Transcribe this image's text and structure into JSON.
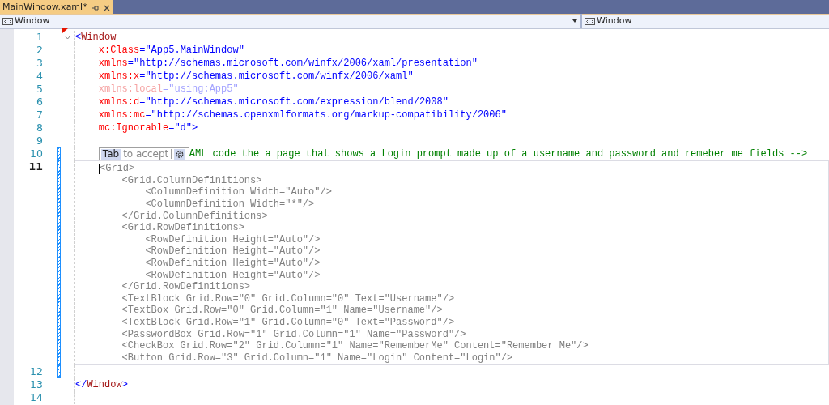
{
  "tab": {
    "title": "MainWindow.xaml*",
    "pinned": false
  },
  "nav": {
    "left": "Window",
    "right": "Window"
  },
  "lines": [
    {
      "number": "1",
      "changed": false,
      "current": false,
      "fold": true,
      "error_mark": true,
      "tokens": [
        {
          "kind": "bracket",
          "text": "<"
        },
        {
          "kind": "tag",
          "text": "Window"
        }
      ]
    },
    {
      "number": "2",
      "changed": false,
      "current": false,
      "tokens": [
        {
          "kind": "attr",
          "text": "    x:Class"
        },
        {
          "kind": "value",
          "text": "=\"App5.MainWindow\""
        }
      ]
    },
    {
      "number": "3",
      "changed": false,
      "current": false,
      "tokens": [
        {
          "kind": "attr",
          "text": "    xmlns"
        },
        {
          "kind": "value",
          "text": "=\"http://schemas.microsoft.com/winfx/2006/xaml/presentation\""
        }
      ]
    },
    {
      "number": "4",
      "changed": false,
      "current": false,
      "tokens": [
        {
          "kind": "attr",
          "text": "    xmlns:x"
        },
        {
          "kind": "value",
          "text": "=\"http://schemas.microsoft.com/winfx/2006/xaml\""
        }
      ]
    },
    {
      "number": "5",
      "changed": false,
      "current": false,
      "tokens": [
        {
          "kind": "faded_attr",
          "text": "    xmlns:local"
        },
        {
          "kind": "faded_value",
          "text": "=\"using:App5\""
        }
      ]
    },
    {
      "number": "6",
      "changed": false,
      "current": false,
      "tokens": [
        {
          "kind": "attr",
          "text": "    xmlns:d"
        },
        {
          "kind": "value",
          "text": "=\"http://schemas.microsoft.com/expression/blend/2008\""
        }
      ]
    },
    {
      "number": "7",
      "changed": false,
      "current": false,
      "tokens": [
        {
          "kind": "attr",
          "text": "    xmlns:mc"
        },
        {
          "kind": "value",
          "text": "=\"http://schemas.openxmlformats.org/markup-compatibility/2006\""
        }
      ]
    },
    {
      "number": "8",
      "changed": false,
      "current": false,
      "tokens": [
        {
          "kind": "attr",
          "text": "    mc:Ignorable"
        },
        {
          "kind": "value",
          "text": "=\"d\">"
        }
      ]
    },
    {
      "number": "9",
      "changed": false,
      "current": false
    },
    {
      "number": "10",
      "changed": true,
      "current": false,
      "hint": {
        "key": "Tab",
        "text": "to accept"
      },
      "tokens": [
        {
          "kind": "comment",
          "text": "AML code the a page that shows a Login prompt made up of a username and password and remeber me fields -->"
        }
      ]
    },
    {
      "number": "11",
      "changed": true,
      "current": true,
      "ghost": [
        "<Grid>",
        "        <Grid.ColumnDefinitions>",
        "            <ColumnDefinition Width=\"Auto\"/>",
        "            <ColumnDefinition Width=\"*\"/>",
        "        </Grid.ColumnDefinitions>",
        "        <Grid.RowDefinitions>",
        "            <RowDefinition Height=\"Auto\"/>",
        "            <RowDefinition Height=\"Auto\"/>",
        "            <RowDefinition Height=\"Auto\"/>",
        "            <RowDefinition Height=\"Auto\"/>",
        "        </Grid.RowDefinitions>",
        "        <TextBlock Grid.Row=\"0\" Grid.Column=\"0\" Text=\"Username\"/>",
        "        <TextBox Grid.Row=\"0\" Grid.Column=\"1\" Name=\"Username\"/>",
        "        <TextBlock Grid.Row=\"1\" Grid.Column=\"0\" Text=\"Password\"/>",
        "        <PasswordBox Grid.Row=\"1\" Grid.Column=\"1\" Name=\"Password\"/>",
        "        <CheckBox Grid.Row=\"2\" Grid.Column=\"1\" Name=\"RememberMe\" Content=\"Remember Me\"/>",
        "        <Button Grid.Row=\"3\" Grid.Column=\"1\" Name=\"Login\" Content=\"Login\"/>"
      ]
    },
    {
      "number": "12",
      "changed": true,
      "current": false
    },
    {
      "number": "13",
      "changed": false,
      "current": false,
      "tokens": [
        {
          "kind": "bracket",
          "text": "</"
        },
        {
          "kind": "tag",
          "text": "Window"
        },
        {
          "kind": "bracket",
          "text": ">"
        }
      ]
    },
    {
      "number": "14",
      "changed": false,
      "current": false
    }
  ]
}
